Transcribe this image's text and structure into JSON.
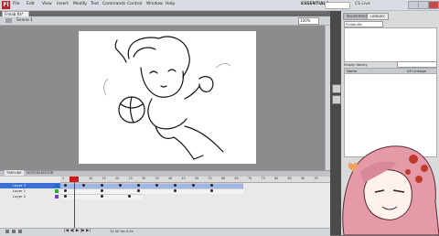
{
  "app": {
    "logo": "Fl"
  },
  "menubar": [
    "File",
    "Edit",
    "View",
    "Insert",
    "Modify",
    "Text",
    "Commands",
    "Control",
    "Window",
    "Help"
  ],
  "workspace": {
    "label": "ESSENTIALS ▾",
    "cslive": "CS Live"
  },
  "document": {
    "tab": "Fmlab.fla*",
    "scene": "Scene 1",
    "zoom": "100%"
  },
  "panels": {
    "tabs": [
      "PROPERTIES",
      "LIBRARY"
    ],
    "library_file": "Fmlab.fla",
    "item_count": "Empty library",
    "columns": {
      "name": "Name",
      "linkage": "AS Linkage"
    }
  },
  "timeline": {
    "tabs": [
      "TIMELINE",
      "MOTION EDITOR"
    ],
    "layers": [
      {
        "name": "Layer 3",
        "selected": true,
        "color": "#2b62c8"
      },
      {
        "name": "Layer 1",
        "selected": false,
        "color": "#28b028"
      },
      {
        "name": "Layer 2",
        "selected": false,
        "color": "#7a3bc0"
      }
    ],
    "ruler": [
      "1",
      "5",
      "10",
      "15",
      "20",
      "25",
      "30",
      "35",
      "40",
      "45",
      "50",
      "55",
      "60",
      "65",
      "70",
      "75",
      "80",
      "85",
      "90",
      "95"
    ],
    "controls": "|◀ ◀| ▶ |▶ ▶|",
    "info": "12.00 fps  0.0s"
  },
  "colors": {
    "accent": "#d31818",
    "hair": "#e59aa8",
    "panel": "#d8dadc"
  }
}
